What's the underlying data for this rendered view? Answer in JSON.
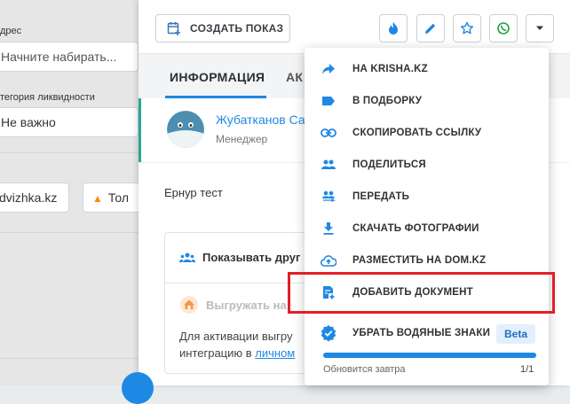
{
  "filters": {
    "address_label": "дрес",
    "address_placeholder": "Начните набирать...",
    "liquidity_label": "тегория ликвидности",
    "liquidity_value": "Не важно",
    "source_tag": "dvizhka.kz",
    "hot_tag": "Тол"
  },
  "toolbar": {
    "create_show_label": "СОЗДАТЬ ПОКАЗ",
    "icons": [
      "fire-icon",
      "pencil-icon",
      "star-icon",
      "whatsapp-icon",
      "caret-down-icon"
    ]
  },
  "tabs": {
    "info": "ИНФОРМАЦИЯ",
    "second": "АК"
  },
  "manager": {
    "name": "Жубатканов Са",
    "role": "Менеджер"
  },
  "owner": "Ернур тест",
  "integration": {
    "show_others": "Показывать друг",
    "export": "Выгружать на ",
    "activation_line1": "Для активации выгру",
    "activation_line2_prefix": "интеграцию в ",
    "activation_link": "личном"
  },
  "menu": {
    "items": [
      {
        "label": "НА KRISHA.KZ",
        "icon": "share-arrow-icon"
      },
      {
        "label": "В ПОДБОРКУ",
        "icon": "label-icon"
      },
      {
        "label": "СКОПИРОВАТЬ ССЫЛКУ",
        "icon": "link-icon"
      },
      {
        "label": "ПОДЕЛИТЬСЯ",
        "icon": "people-icon"
      },
      {
        "label": "ПЕРЕДАТЬ",
        "icon": "transfer-people-icon"
      },
      {
        "label": "СКАЧАТЬ ФОТОГРАФИИ",
        "icon": "download-icon"
      },
      {
        "label": "РАЗМЕСТИТЬ НА DOM.KZ",
        "icon": "cloud-upload-icon"
      },
      {
        "label": "ДОБАВИТЬ ДОКУМЕНТ",
        "icon": "add-document-icon"
      }
    ],
    "watermark_label": "УБРАТЬ ВОДЯНЫЕ ЗНАКИ",
    "beta_badge": "Beta",
    "usage_note": "Обновится завтра",
    "usage_count": "1/1",
    "usage_fraction": 1.0
  },
  "colors": {
    "accent": "#1e88e5",
    "highlight": "#e41e25",
    "manager_accent": "#26a69a",
    "fire": "#1e88e5",
    "whatsapp": "#25a244"
  }
}
